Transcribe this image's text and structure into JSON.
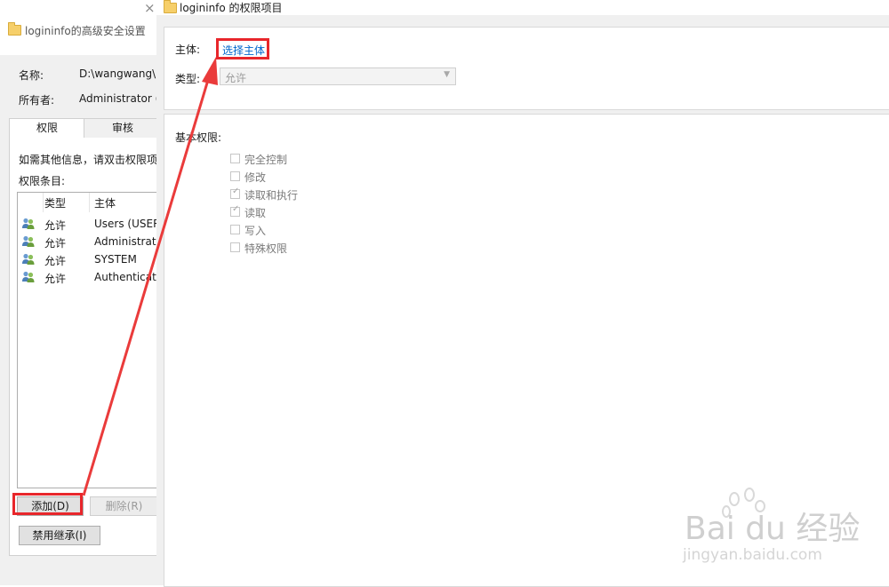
{
  "left_window": {
    "title": "logininfo的高级安全设置",
    "close_glyph": "×",
    "name_label": "名称:",
    "name_value": "D:\\wangwang\\p",
    "owner_label": "所有者:",
    "owner_value": "Administrator (",
    "tabs": [
      "权限",
      "审核"
    ],
    "info_text": "如需其他信息，请双击权限项",
    "entries_label": "权限条目:",
    "columns": [
      "类型",
      "主体"
    ],
    "rows": [
      {
        "type": "允许",
        "principal": "Users (USER"
      },
      {
        "type": "允许",
        "principal": "Administrato"
      },
      {
        "type": "允许",
        "principal": "SYSTEM"
      },
      {
        "type": "允许",
        "principal": "Authenticate"
      }
    ],
    "add_button": "添加(D)",
    "remove_button": "删除(R)",
    "disable_inheritance_button": "禁用继承(I)"
  },
  "right_window": {
    "title": "logininfo 的权限项目",
    "principal_label": "主体:",
    "select_principal_link": "选择主体",
    "type_label": "类型:",
    "type_value": "允许",
    "basic_permissions_label": "基本权限:",
    "permissions": [
      {
        "label": "完全控制",
        "checked": false
      },
      {
        "label": "修改",
        "checked": false
      },
      {
        "label": "读取和执行",
        "checked": true
      },
      {
        "label": "读取",
        "checked": true
      },
      {
        "label": "写入",
        "checked": false
      },
      {
        "label": "特殊权限",
        "checked": false
      }
    ]
  },
  "watermark": {
    "text": "Bai du 经验",
    "url": "jingyan.baidu.com"
  },
  "colors": {
    "highlight": "#e8262b",
    "link": "#0066cc",
    "folder": "#f6cf6a"
  }
}
